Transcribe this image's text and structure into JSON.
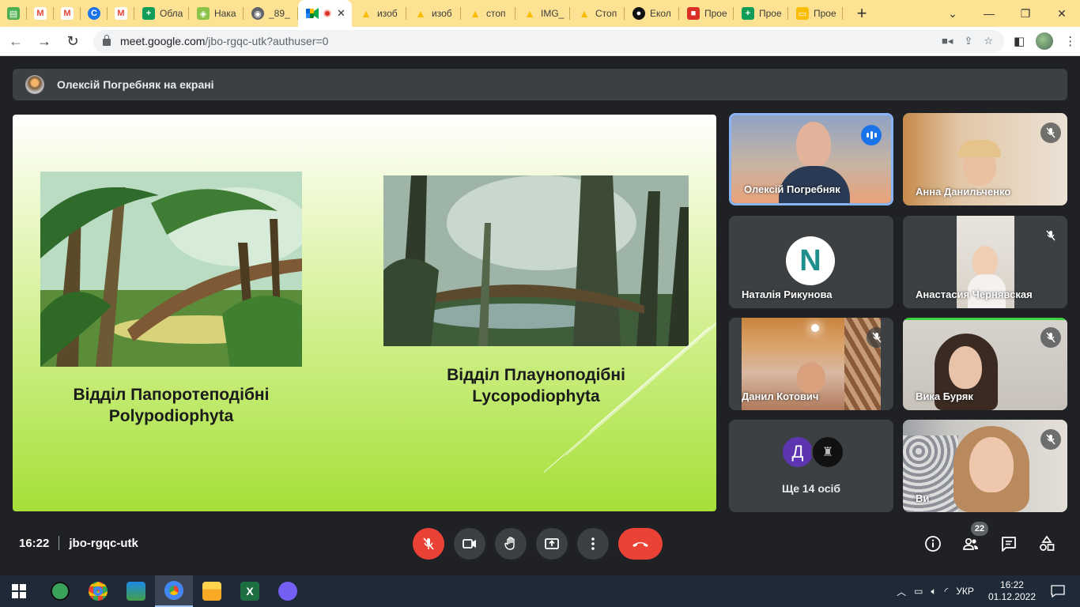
{
  "browser": {
    "tabs": [
      {
        "title": "",
        "fav_color": "#4caf50",
        "fav_glyph": "▤"
      },
      {
        "title": "",
        "fav_color": "#ea4335",
        "fav_glyph": "M"
      },
      {
        "title": "",
        "fav_color": "#ea4335",
        "fav_glyph": "M"
      },
      {
        "title": "",
        "fav_color": "#1a73e8",
        "fav_glyph": "C"
      },
      {
        "title": "",
        "fav_color": "#ea4335",
        "fav_glyph": "M"
      },
      {
        "title": "Обла",
        "fav_color": "#0f9d58",
        "fav_glyph": "+"
      },
      {
        "title": "Нака",
        "fav_color": "#8bc34a",
        "fav_glyph": "◈"
      },
      {
        "title": "_89_",
        "fav_color": "#5f6368",
        "fav_glyph": "◉"
      },
      {
        "title": "изоб",
        "fav_color": "#fbbc04",
        "fav_glyph": "▲"
      },
      {
        "title": "изоб",
        "fav_color": "#fbbc04",
        "fav_glyph": "▲"
      },
      {
        "title": "стоп",
        "fav_color": "#fbbc04",
        "fav_glyph": "▲"
      },
      {
        "title": "IMG_",
        "fav_color": "#fbbc04",
        "fav_glyph": "▲"
      },
      {
        "title": "Стоп",
        "fav_color": "#fbbc04",
        "fav_glyph": "▲"
      },
      {
        "title": "Екол",
        "fav_color": "#111111",
        "fav_glyph": "●"
      },
      {
        "title": "Прое",
        "fav_color": "#d93025",
        "fav_glyph": "■"
      },
      {
        "title": "Прое",
        "fav_color": "#0f9d58",
        "fav_glyph": "+"
      },
      {
        "title": "Прое",
        "fav_color": "#fbbc04",
        "fav_glyph": "▭"
      }
    ],
    "active_tab_index": 8,
    "url_host": "meet.google.com",
    "url_path": "/jbo-rgqc-utk?authuser=0"
  },
  "meet": {
    "presenter_banner": "Олексій Погребняк на екрані",
    "slide": {
      "caption_left_line1": "Відділ Папоротеподібні",
      "caption_left_line2": "Polypodiophyta",
      "caption_right_line1": "Відділ Плауноподібні",
      "caption_right_line2": "Lycopodiophyta"
    },
    "participants": [
      {
        "name": "Олексій Погребняк",
        "speaking": true,
        "muted": false
      },
      {
        "name": "Анна Данильченко",
        "speaking": false,
        "muted": true
      },
      {
        "name": "Наталія Рикунова",
        "speaking": false,
        "muted": false,
        "avatar_letter": "N"
      },
      {
        "name": "Анастасия Чернявская",
        "speaking": false,
        "muted": true
      },
      {
        "name": "Данил Котович",
        "speaking": false,
        "muted": true
      },
      {
        "name": "Вика Буряк",
        "speaking": false,
        "muted": true
      },
      {
        "name": "Ви",
        "speaking": false,
        "muted": true
      }
    ],
    "more": {
      "avatar_letter": "Д",
      "label": "Ще 14 осіб"
    },
    "time": "16:22",
    "meeting_code": "jbo-rgqc-utk",
    "people_count": "22"
  },
  "taskbar": {
    "lang": "УКР",
    "time": "16:22",
    "date": "01.12.2022"
  },
  "colors": {
    "accent_blue": "#1a73e8",
    "end_call_red": "#ea4335",
    "meet_bg": "#202124",
    "tabstrip_bg": "#fde293"
  }
}
